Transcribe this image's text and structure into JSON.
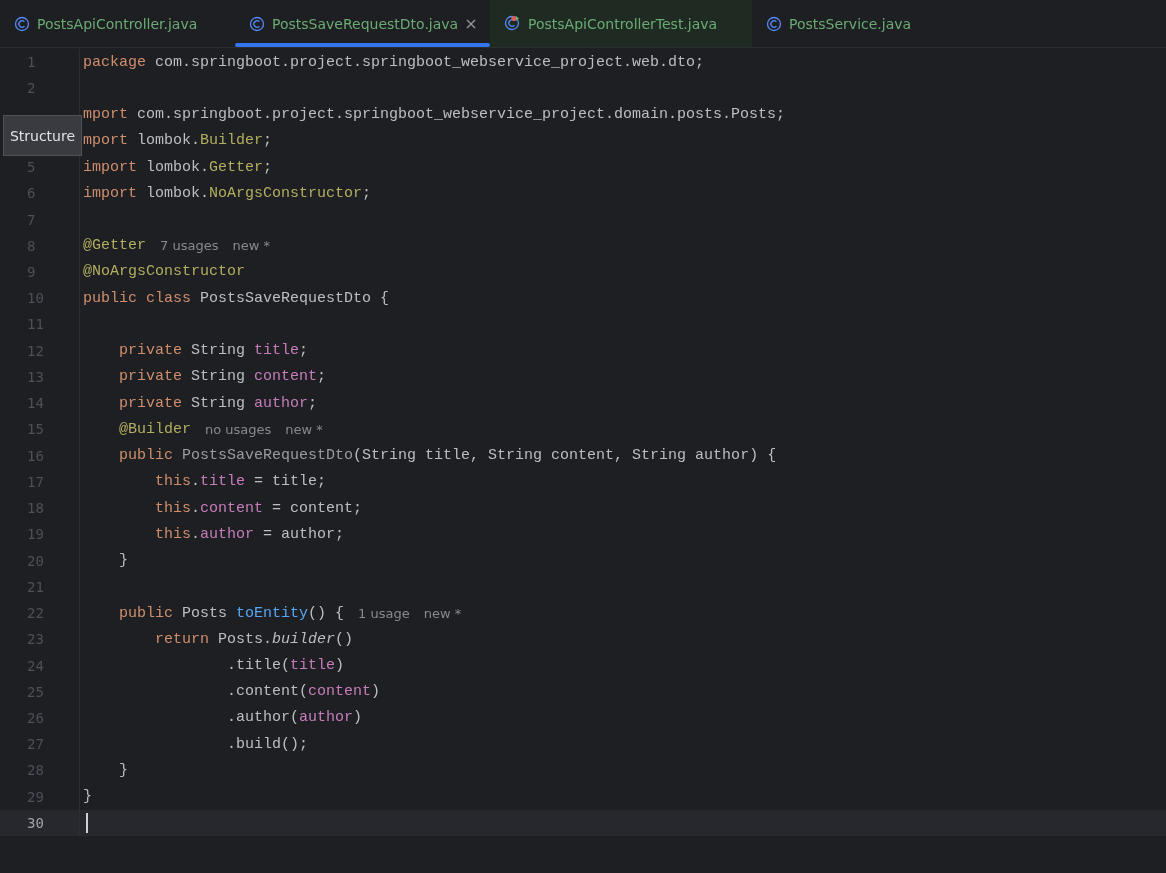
{
  "tabs": [
    {
      "label": "PostsApiController.java",
      "kind": "class",
      "selected": false
    },
    {
      "label": "PostsSaveRequestDto.java",
      "kind": "class",
      "selected": true
    },
    {
      "label": "PostsApiControllerTest.java",
      "kind": "test",
      "selected": false
    },
    {
      "label": "PostsService.java",
      "kind": "class",
      "selected": false
    }
  ],
  "tooltip": {
    "text": "Structure"
  },
  "lines": [
    {
      "number": "1",
      "current": false,
      "tokens": [
        {
          "kind": "keyword",
          "text": "package "
        },
        {
          "kind": "plain",
          "text": "com.springboot.project.springboot_webservice_project.web.dto;"
        }
      ]
    },
    {
      "number": "2",
      "current": false
    },
    {
      "current": false,
      "tokens": [
        {
          "kind": "keyword",
          "text": "mport "
        },
        {
          "kind": "plain",
          "text": "com.springboot.project.springboot_webservice_project.domain.posts.Posts;"
        }
      ]
    },
    {
      "current": false,
      "tokens": [
        {
          "kind": "keyword",
          "text": "mport "
        },
        {
          "kind": "plain",
          "text": "lombok."
        },
        {
          "kind": "annotation",
          "text": "Builder"
        },
        {
          "kind": "plain",
          "text": ";"
        }
      ]
    },
    {
      "number": "5",
      "current": false,
      "tokens": [
        {
          "kind": "keyword",
          "text": "import "
        },
        {
          "kind": "plain",
          "text": "lombok."
        },
        {
          "kind": "annotation",
          "text": "Getter"
        },
        {
          "kind": "plain",
          "text": ";"
        }
      ]
    },
    {
      "number": "6",
      "current": false,
      "tokens": [
        {
          "kind": "keyword",
          "text": "import "
        },
        {
          "kind": "plain",
          "text": "lombok."
        },
        {
          "kind": "annotation",
          "text": "NoArgsConstructor"
        },
        {
          "kind": "plain",
          "text": ";"
        }
      ]
    },
    {
      "number": "7",
      "current": false
    },
    {
      "number": "8",
      "current": false,
      "tokens": [
        {
          "kind": "annotation",
          "text": "@Getter"
        }
      ],
      "hints": [
        "7 usages",
        "new *"
      ]
    },
    {
      "number": "9",
      "current": false,
      "tokens": [
        {
          "kind": "annotation",
          "text": "@NoArgsConstructor"
        }
      ]
    },
    {
      "number": "10",
      "current": false,
      "tokens": [
        {
          "kind": "keyword",
          "text": "public class "
        },
        {
          "kind": "plain",
          "text": "PostsSaveRequestDto {"
        }
      ]
    },
    {
      "number": "11",
      "current": false
    },
    {
      "number": "12",
      "current": false,
      "tokens": [
        {
          "kind": "keyword",
          "text": "    private "
        },
        {
          "kind": "plain",
          "text": "String "
        },
        {
          "kind": "field",
          "text": "title"
        },
        {
          "kind": "plain",
          "text": ";"
        }
      ]
    },
    {
      "number": "13",
      "current": false,
      "tokens": [
        {
          "kind": "keyword",
          "text": "    private "
        },
        {
          "kind": "plain",
          "text": "String "
        },
        {
          "kind": "field",
          "text": "content"
        },
        {
          "kind": "plain",
          "text": ";"
        }
      ]
    },
    {
      "number": "14",
      "current": false,
      "tokens": [
        {
          "kind": "keyword",
          "text": "    private "
        },
        {
          "kind": "plain",
          "text": "String "
        },
        {
          "kind": "field",
          "text": "author"
        },
        {
          "kind": "plain",
          "text": ";"
        }
      ]
    },
    {
      "number": "15",
      "current": false,
      "tokens": [
        {
          "kind": "annotation",
          "text": "    @Builder"
        }
      ],
      "hints": [
        "no usages",
        "new *"
      ]
    },
    {
      "number": "16",
      "current": false,
      "tokens": [
        {
          "kind": "keyword",
          "text": "    public "
        },
        {
          "kind": "unused",
          "text": "PostsSaveRequestDto"
        },
        {
          "kind": "plain",
          "text": "(String title, String content, String author) {"
        }
      ]
    },
    {
      "number": "17",
      "current": false,
      "tokens": [
        {
          "kind": "keyword",
          "text": "        this"
        },
        {
          "kind": "plain",
          "text": "."
        },
        {
          "kind": "field",
          "text": "title"
        },
        {
          "kind": "plain",
          "text": " = title;"
        }
      ]
    },
    {
      "number": "18",
      "current": false,
      "tokens": [
        {
          "kind": "keyword",
          "text": "        this"
        },
        {
          "kind": "plain",
          "text": "."
        },
        {
          "kind": "field",
          "text": "content"
        },
        {
          "kind": "plain",
          "text": " = content;"
        }
      ]
    },
    {
      "number": "19",
      "current": false,
      "tokens": [
        {
          "kind": "keyword",
          "text": "        this"
        },
        {
          "kind": "plain",
          "text": "."
        },
        {
          "kind": "field",
          "text": "author"
        },
        {
          "kind": "plain",
          "text": " = author;"
        }
      ]
    },
    {
      "number": "20",
      "current": false,
      "tokens": [
        {
          "kind": "plain",
          "text": "    }"
        }
      ]
    },
    {
      "number": "21",
      "current": false
    },
    {
      "number": "22",
      "current": false,
      "tokens": [
        {
          "kind": "keyword",
          "text": "    public "
        },
        {
          "kind": "plain",
          "text": "Posts "
        },
        {
          "kind": "method",
          "text": "toEntity"
        },
        {
          "kind": "plain",
          "text": "() {"
        }
      ],
      "hints": [
        "1 usage",
        "new *"
      ]
    },
    {
      "number": "23",
      "current": false,
      "tokens": [
        {
          "kind": "keyword",
          "text": "        return "
        },
        {
          "kind": "plain",
          "text": "Posts."
        },
        {
          "kind": "static",
          "text": "builder"
        },
        {
          "kind": "plain",
          "text": "()"
        }
      ]
    },
    {
      "number": "24",
      "current": false,
      "tokens": [
        {
          "kind": "plain",
          "text": "                .title("
        },
        {
          "kind": "field",
          "text": "title"
        },
        {
          "kind": "plain",
          "text": ")"
        }
      ]
    },
    {
      "number": "25",
      "current": false,
      "tokens": [
        {
          "kind": "plain",
          "text": "                .content("
        },
        {
          "kind": "field",
          "text": "content"
        },
        {
          "kind": "plain",
          "text": ")"
        }
      ]
    },
    {
      "number": "26",
      "current": false,
      "tokens": [
        {
          "kind": "plain",
          "text": "                .author("
        },
        {
          "kind": "field",
          "text": "author"
        },
        {
          "kind": "plain",
          "text": ")"
        }
      ]
    },
    {
      "number": "27",
      "current": false,
      "tokens": [
        {
          "kind": "plain",
          "text": "                .build();"
        }
      ]
    },
    {
      "number": "28",
      "current": false,
      "tokens": [
        {
          "kind": "plain",
          "text": "    }"
        }
      ]
    },
    {
      "number": "29",
      "current": false,
      "tokens": [
        {
          "kind": "plain",
          "text": "}"
        }
      ]
    },
    {
      "number": "30",
      "current": true
    }
  ]
}
